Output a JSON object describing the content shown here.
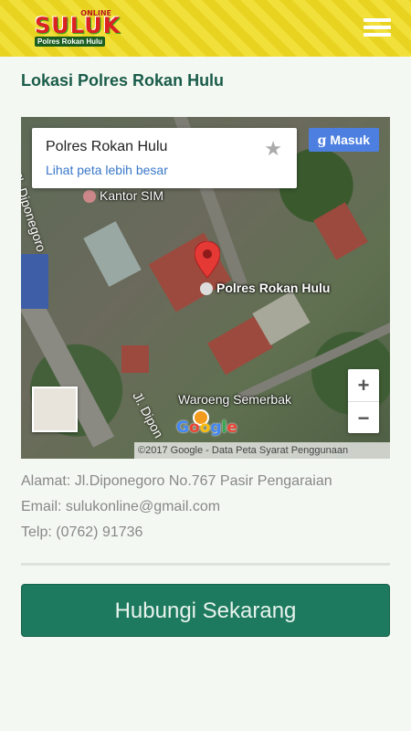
{
  "header": {
    "logo_online": "ONLINE",
    "logo_brand": "SULUK",
    "logo_sub": "Polres Rokan Hulu",
    "menu_icon": "hamburger-menu-icon"
  },
  "page": {
    "title": "Lokasi Polres Rokan Hulu"
  },
  "map": {
    "card_place": "Polres Rokan Hulu",
    "card_link": "Lihat peta lebih besar",
    "star_icon": "star-icon",
    "signin_g": "g",
    "signin_label": "Masuk",
    "labels": {
      "street_north": "Jl. Diponegoro",
      "street_south": "Jl. Dipon",
      "kantor": "Kantor SIM",
      "polres": "Polres Rokan Hulu",
      "waroeng": "Waroeng Semerbak"
    },
    "zoom_in": "+",
    "zoom_out": "−",
    "google_logo": "Google",
    "attribution": "©2017 Google - Data Peta   Syarat Penggunaan"
  },
  "contact": {
    "address": "Alamat: Jl.Diponegoro No.767 Pasir Pengaraian",
    "email": "Email: sulukonline@gmail.com",
    "phone": "Telp: (0762) 91736"
  },
  "cta": {
    "label": "Hubungi Sekarang"
  },
  "colors": {
    "accent": "#1e7a5e",
    "title": "#1a5c4a",
    "header": "#e9d321",
    "link": "#3a78c9"
  }
}
